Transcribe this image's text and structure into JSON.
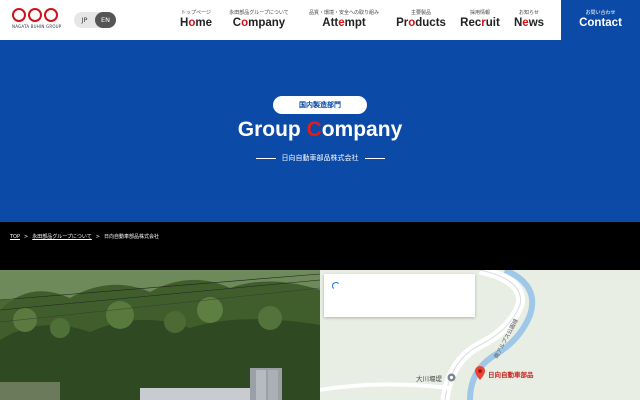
{
  "brand": {
    "logo_text": "NAGATA BUHIN GROUP"
  },
  "lang": {
    "jp": "JP",
    "en": "EN",
    "active": "EN"
  },
  "nav": [
    {
      "sub": "トップページ",
      "main_pre": "H",
      "main_red": "o",
      "main_post": "me"
    },
    {
      "sub": "永田部品グループについて",
      "main_pre": "C",
      "main_red": "o",
      "main_post": "mpany"
    },
    {
      "sub": "品質・環境・安全への取り組み",
      "main_pre": "Att",
      "main_red": "e",
      "main_post": "mpt"
    },
    {
      "sub": "主要製品",
      "main_pre": "Pr",
      "main_red": "o",
      "main_post": "ducts"
    },
    {
      "sub": "採用情報",
      "main_pre": "Rec",
      "main_red": "r",
      "main_post": "uit"
    },
    {
      "sub": "お知らせ",
      "main_pre": "N",
      "main_red": "e",
      "main_post": "ws"
    }
  ],
  "contact": {
    "sub": "お問い合わせ",
    "main": "Contact"
  },
  "hero": {
    "pill": "国内製造部門",
    "title_pre": "Group ",
    "title_red": "C",
    "title_post": "ompany",
    "subtitle": "日向自動車部品株式会社"
  },
  "breadcrumb": [
    {
      "label": "TOP",
      "link": true
    },
    {
      "label": "永田部品グループについて",
      "link": true
    },
    {
      "label": "日向自動車部品株式会社",
      "link": false
    }
  ],
  "breadcrumb_sep": ">",
  "map": {
    "place_label": "日向自動車部品",
    "dam_label": "大川堰堤",
    "road_label": "南アルプス公園線"
  },
  "colors": {
    "primary": "#0b4aa6",
    "accent": "#d0121b"
  }
}
